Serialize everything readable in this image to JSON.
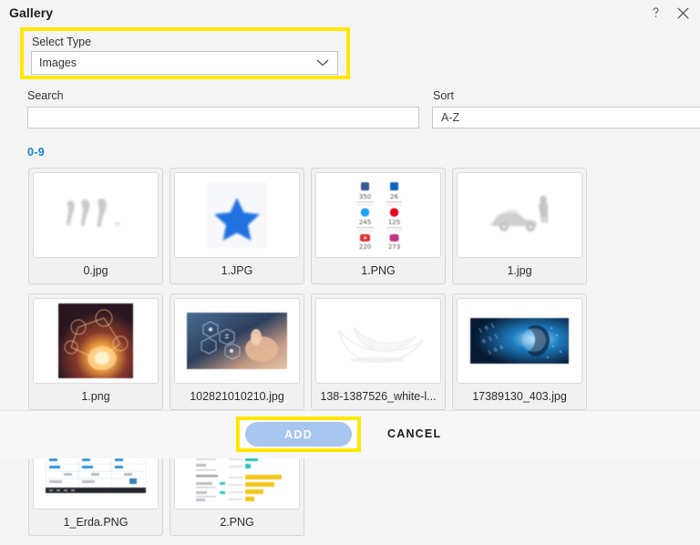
{
  "window": {
    "title": "Gallery",
    "help_icon": "question-mark-icon",
    "close_icon": "close-icon"
  },
  "select_type": {
    "label": "Select Type",
    "value": "Images",
    "chevron_icon": "chevron-down-icon",
    "highlight_color": "#ffe700"
  },
  "search": {
    "label": "Search",
    "value": "",
    "placeholder": ""
  },
  "sort": {
    "label": "Sort",
    "value": "A-Z"
  },
  "section": {
    "header": "0-9",
    "header_color": "#1d7fd0"
  },
  "gallery": {
    "items": [
      {
        "name": "0.jpg",
        "art": "figures"
      },
      {
        "name": "1.JPG",
        "art": "star"
      },
      {
        "name": "1.PNG",
        "art": "social-stats"
      },
      {
        "name": "1.jpg",
        "art": "car"
      },
      {
        "name": "1.png",
        "art": "glow-network"
      },
      {
        "name": "102821010210.jpg",
        "art": "hand-hexagons"
      },
      {
        "name": "138-1387526_white-l...",
        "art": "white-swoosh"
      },
      {
        "name": "17389130_403.jpg",
        "art": "binary-face"
      },
      {
        "name": "1_Erda.PNG",
        "art": "spreadsheet"
      },
      {
        "name": "2.PNG",
        "art": "bar-report"
      }
    ]
  },
  "social_stats": {
    "rows": [
      {
        "left_icon": "facebook-icon",
        "left_value": "350",
        "right_icon": "linkedin-icon",
        "right_value": "26"
      },
      {
        "left_icon": "twitter-icon",
        "left_value": "245",
        "right_icon": "pinterest-icon",
        "right_value": "125"
      },
      {
        "left_icon": "youtube-icon",
        "left_value": "220",
        "right_icon": "instagram-icon",
        "right_value": "273"
      }
    ]
  },
  "footer": {
    "add_label": "ADD",
    "cancel_label": "CANCEL",
    "add_bg": "#a8c6ef",
    "add_highlight_color": "#ffe700"
  }
}
